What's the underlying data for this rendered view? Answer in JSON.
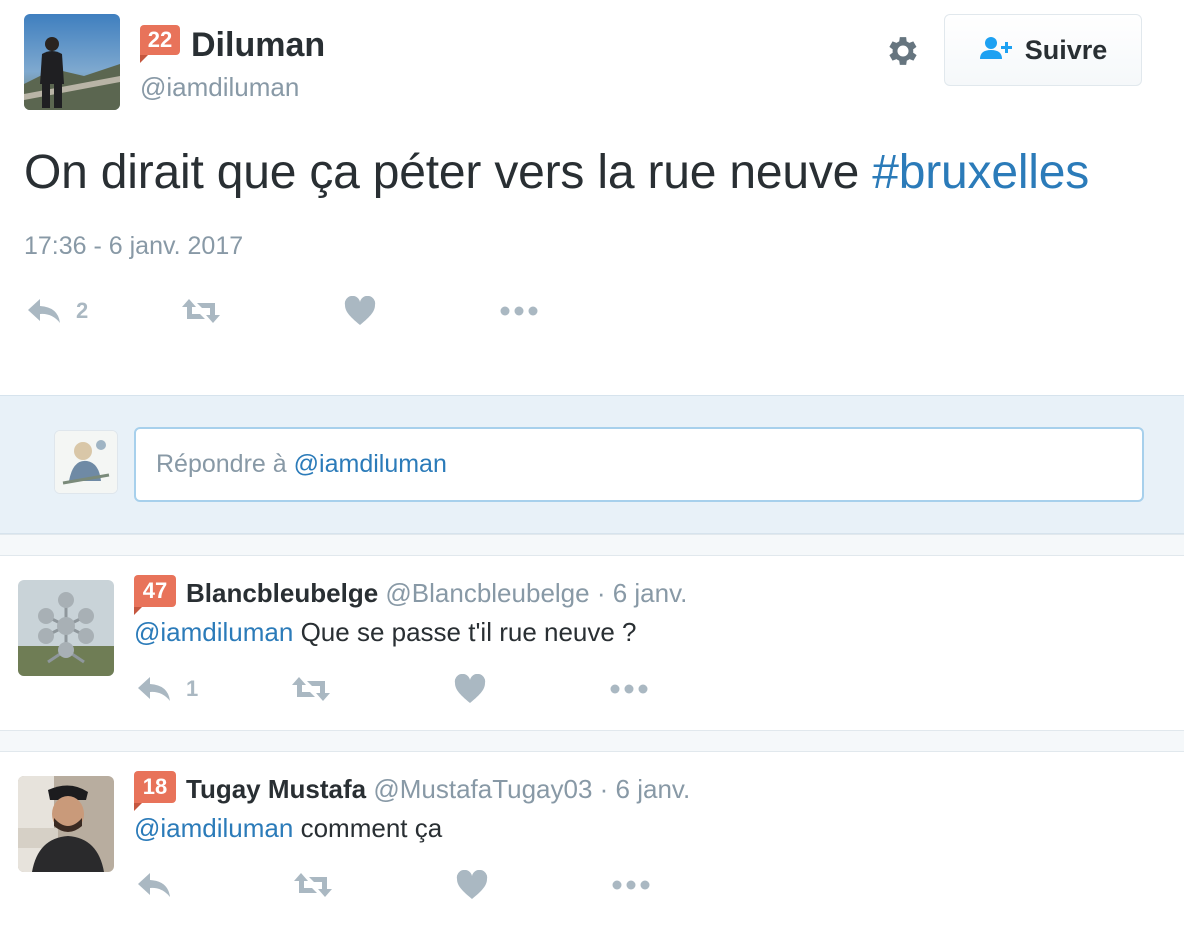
{
  "main_tweet": {
    "badge": "22",
    "name": "Diluman",
    "handle": "@iamdiluman",
    "follow_label": "Suivre",
    "text": "On dirait que ça péter vers la rue neuve ",
    "hashtag": "#bruxelles",
    "timestamp": "17:36 - 6 janv. 2017",
    "reply_count": "2"
  },
  "reply_box": {
    "prefix": "Répondre à",
    "mention": "@iamdiluman"
  },
  "replies": [
    {
      "badge": "47",
      "name": "Blancbleubelge",
      "meta": "@Blancbleubelge · 6 janv.",
      "mention": "@iamdiluman",
      "text": "Que se passe t'il rue neuve ?",
      "reply_count": "1"
    },
    {
      "badge": "18",
      "name": "Tugay Mustafa",
      "meta": "@MustafaTugay03 · 6 janv.",
      "mention": "@iamdiluman",
      "text": "comment ça",
      "reply_count": ""
    }
  ],
  "colors": {
    "link": "#2b7bb9",
    "muted": "#8899a6",
    "icon": "#aab8c2",
    "badge": "#e8735a",
    "reply_bg": "#e8f1f8"
  },
  "icons": [
    "gear-icon",
    "follow-user-icon",
    "reply-icon",
    "retweet-icon",
    "like-icon",
    "more-icon"
  ]
}
